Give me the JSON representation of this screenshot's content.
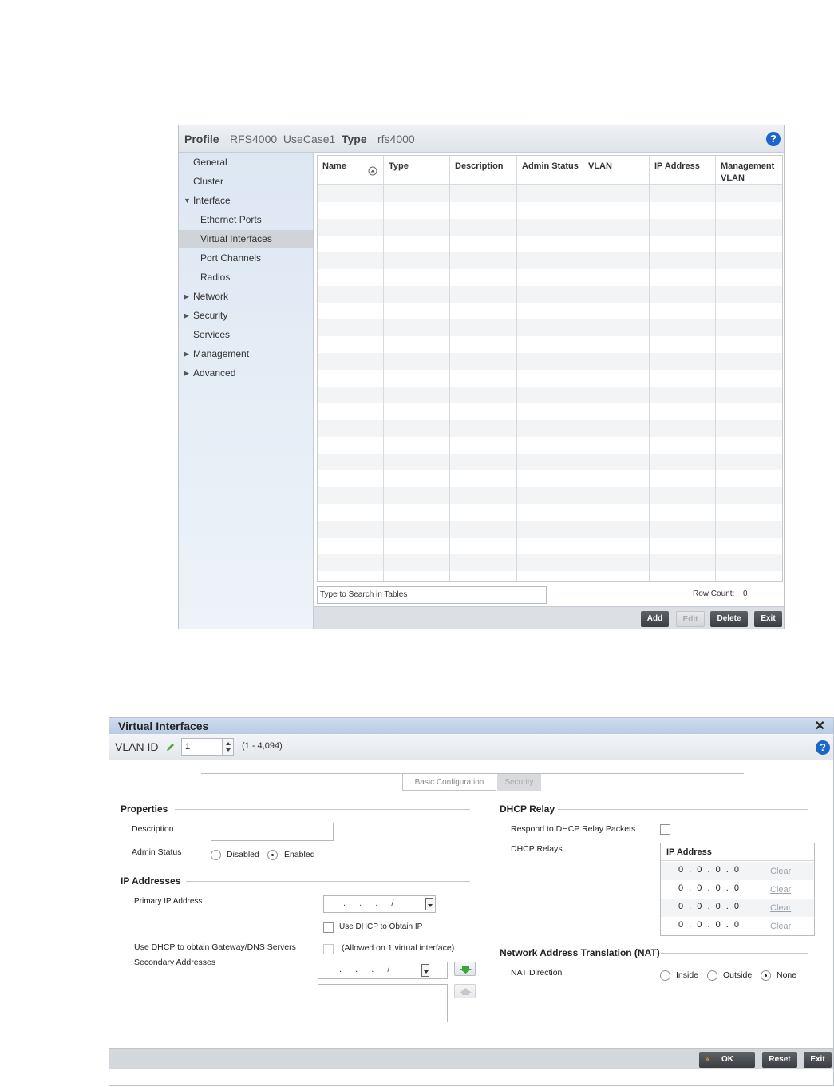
{
  "profile_panel": {
    "profile_label": "Profile",
    "profile_value": "RFS4000_UseCase1",
    "type_label": "Type",
    "type_value": "rfs4000",
    "help_glyph": "?",
    "nav": [
      {
        "label": "General",
        "arrow": ""
      },
      {
        "label": "Cluster",
        "arrow": ""
      },
      {
        "label": "Interface",
        "arrow": "▼"
      },
      {
        "label": "Ethernet Ports",
        "arrow": ""
      },
      {
        "label": "Virtual Interfaces",
        "arrow": "",
        "selected": true
      },
      {
        "label": "Port Channels",
        "arrow": ""
      },
      {
        "label": "Radios",
        "arrow": ""
      },
      {
        "label": "Network",
        "arrow": "▶"
      },
      {
        "label": "Security",
        "arrow": "▶"
      },
      {
        "label": "Services",
        "arrow": ""
      },
      {
        "label": "Management",
        "arrow": "▶"
      },
      {
        "label": "Advanced",
        "arrow": "▶"
      }
    ],
    "table": {
      "columns": [
        "Name",
        "Type",
        "Description",
        "Admin Status",
        "VLAN",
        "IP Address",
        "Management VLAN"
      ],
      "rows": []
    },
    "search_placeholder": "Type to Search in Tables",
    "row_count_label": "Row Count:",
    "row_count_value": "0",
    "buttons": {
      "add": "Add",
      "edit": "Edit",
      "delete": "Delete",
      "exit": "Exit"
    }
  },
  "vi_dialog": {
    "title": "Virtual Interfaces",
    "close_glyph": "✕",
    "vlan_label": "VLAN ID",
    "vlan_value": "1",
    "vlan_range": "(1 - 4,094)",
    "tabs": [
      "Basic Configuration",
      "Security"
    ],
    "properties": {
      "title": "Properties",
      "description_label": "Description",
      "admin_status_label": "Admin Status",
      "disabled_label": "Disabled",
      "enabled_label": "Enabled",
      "admin_status_value": "Enabled"
    },
    "ip_addresses": {
      "title": "IP Addresses",
      "primary_label": "Primary IP Address",
      "primary_value": ". . . /",
      "use_dhcp_label": "Use DHCP to Obtain IP",
      "use_dhcp_gw_label": "Use DHCP to obtain Gateway/DNS Servers",
      "allowed_note": "(Allowed on 1 virtual interface)",
      "secondary_label": "Secondary Addresses",
      "secondary_value": ". . . /"
    },
    "dhcp_relay": {
      "title": "DHCP Relay",
      "respond_label": "Respond to DHCP Relay Packets",
      "relays_label": "DHCP Relays",
      "ip_header": "IP Address",
      "relays": [
        "0 . 0 . 0 . 0",
        "0 . 0 . 0 . 0",
        "0 . 0 . 0 . 0",
        "0 . 0 . 0 . 0"
      ],
      "clear_label": "Clear"
    },
    "nat": {
      "title": "Network Address Translation (NAT)",
      "direction_label": "NAT Direction",
      "options": [
        "Inside",
        "Outside",
        "None"
      ],
      "selected": "None"
    },
    "buttons": {
      "ok": "OK",
      "reset": "Reset",
      "exit": "Exit"
    }
  }
}
